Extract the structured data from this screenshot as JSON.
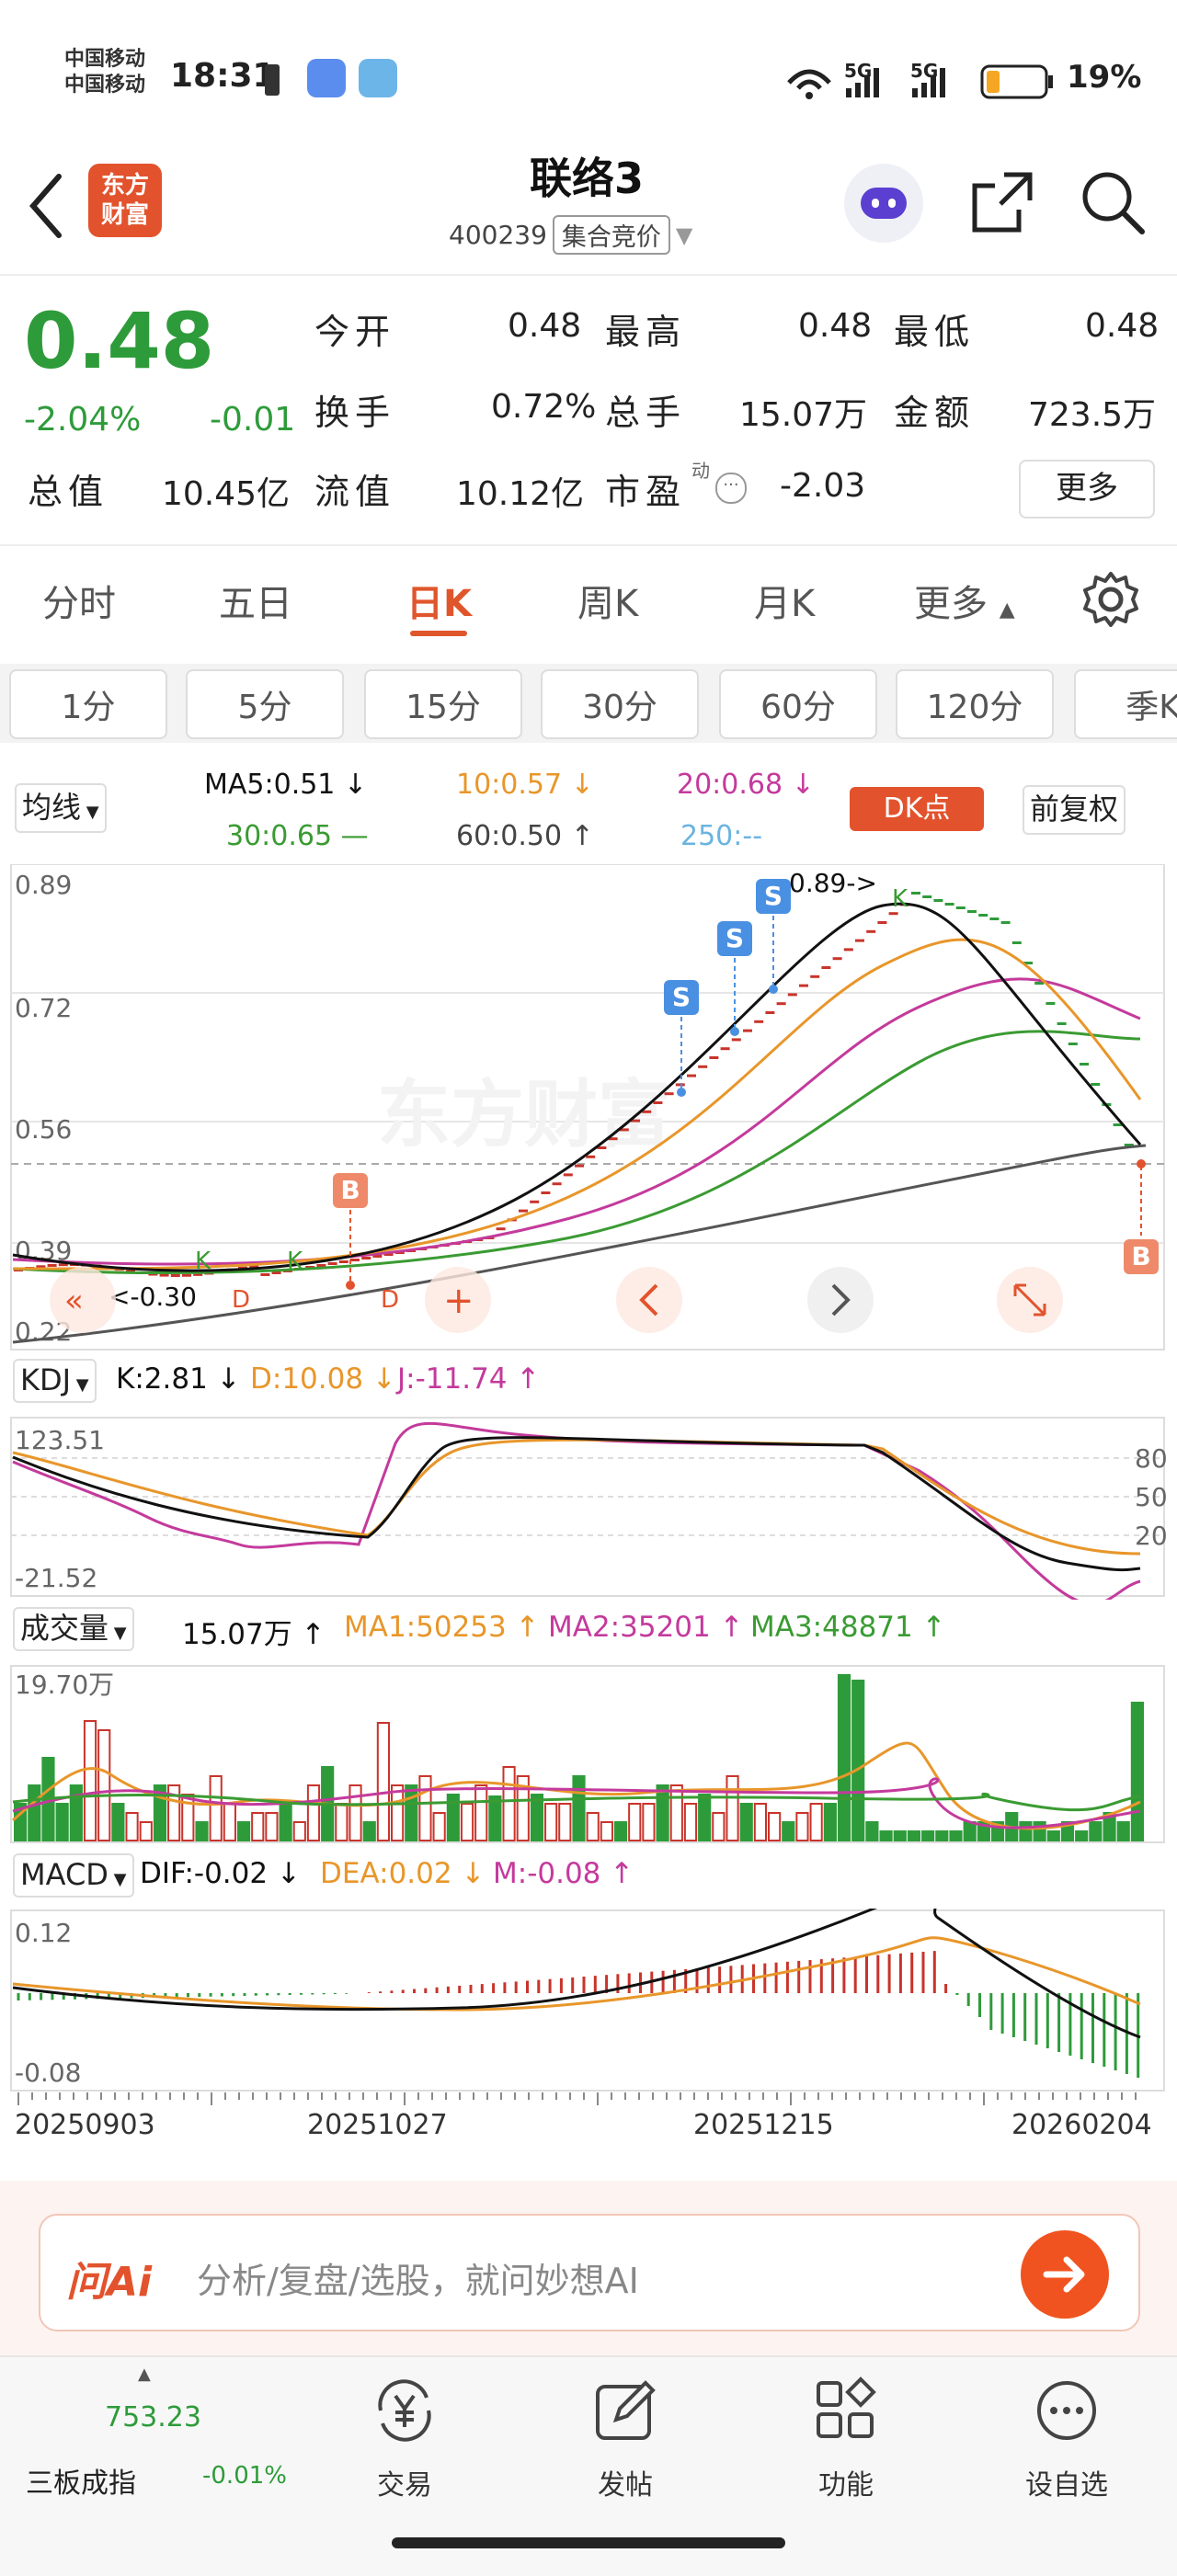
{
  "status": {
    "carrier1": "中国移动",
    "carrier2": "中国移动",
    "time": "18:31",
    "battery": "19%",
    "net1": "5G",
    "net2": "5G"
  },
  "header": {
    "logo_line1": "东方",
    "logo_line2": "财富",
    "title": "联络3",
    "code": "400239",
    "tag": "集合竞价"
  },
  "quote": {
    "price": "0.48",
    "pct": "-2.04%",
    "chg": "-0.01",
    "open_label": "今开",
    "open": "0.48",
    "high_label": "最高",
    "high": "0.48",
    "low_label": "最低",
    "low": "0.48",
    "turnover_label": "换手",
    "turnover": "0.72%",
    "vol_label": "总手",
    "vol": "15.07万",
    "amount_label": "金额",
    "amount": "723.5万",
    "mcap_label": "总值",
    "mcap": "10.45亿",
    "float_label": "流值",
    "float": "10.12亿",
    "pe_label": "市盈",
    "pe_sup": "动",
    "pe": "-2.03",
    "more": "更多"
  },
  "tabs": [
    "分时",
    "五日",
    "日K",
    "周K",
    "月K",
    "更多"
  ],
  "period_tabs": [
    "1分",
    "5分",
    "15分",
    "30分",
    "60分",
    "120分",
    "季K"
  ],
  "ma_bar": {
    "selector": "均线",
    "ma5": "MA5:0.51 ↓",
    "ma10": "10:0.57 ↓",
    "ma20": "20:0.68 ↓",
    "ma30": "30:0.65 —",
    "ma60": "60:0.50 ↑",
    "ma250": "250:--",
    "dk": "DK点",
    "fq": "前复权"
  },
  "kline": {
    "ylabels": [
      "0.89",
      "0.72",
      "0.56",
      "0.39",
      "0.22"
    ],
    "peak_label": "0.89->",
    "low_label": "<-0.30",
    "k": "K",
    "d": "D",
    "s": "S",
    "b": "B",
    "watermark": "东方财富"
  },
  "kdj": {
    "selector": "KDJ",
    "k": "K:2.81 ↓",
    "d": "D:10.08 ↓",
    "j": "J:-11.74 ↑",
    "ymax": "123.51",
    "ymin": "-21.52",
    "levels": [
      "80",
      "50",
      "20"
    ]
  },
  "volume": {
    "selector": "成交量",
    "total": "15.07万 ↑",
    "ma1": "MA1:50253 ↑",
    "ma2": "MA2:35201 ↑",
    "ma3": "MA3:48871 ↑",
    "ymax": "19.70万"
  },
  "macd": {
    "selector": "MACD",
    "dif": "DIF:-0.02 ↓",
    "dea": "DEA:0.02 ↓",
    "m": "M:-0.08 ↑",
    "ymax": "0.12",
    "ymin": "-0.08"
  },
  "dates": [
    "20250903",
    "20251027",
    "20251215",
    "20260204"
  ],
  "ai": {
    "logo": "问Ai",
    "placeholder": "分析/复盘/选股，就问妙想AI"
  },
  "bottom": {
    "index_value": "753.23",
    "index_name": "三板成指",
    "index_pct": "-0.01%",
    "trade": "交易",
    "post": "发帖",
    "func": "功能",
    "custom": "设自选"
  },
  "colors": {
    "up": "#c8342b",
    "down": "#2e9b3a",
    "accent": "#e0562c",
    "ma5": "#111111",
    "ma10": "#e8962a",
    "ma20": "#c43a9c",
    "ma30": "#3a9b32",
    "ma60": "#555555",
    "ma250": "#5aa9d8"
  }
}
